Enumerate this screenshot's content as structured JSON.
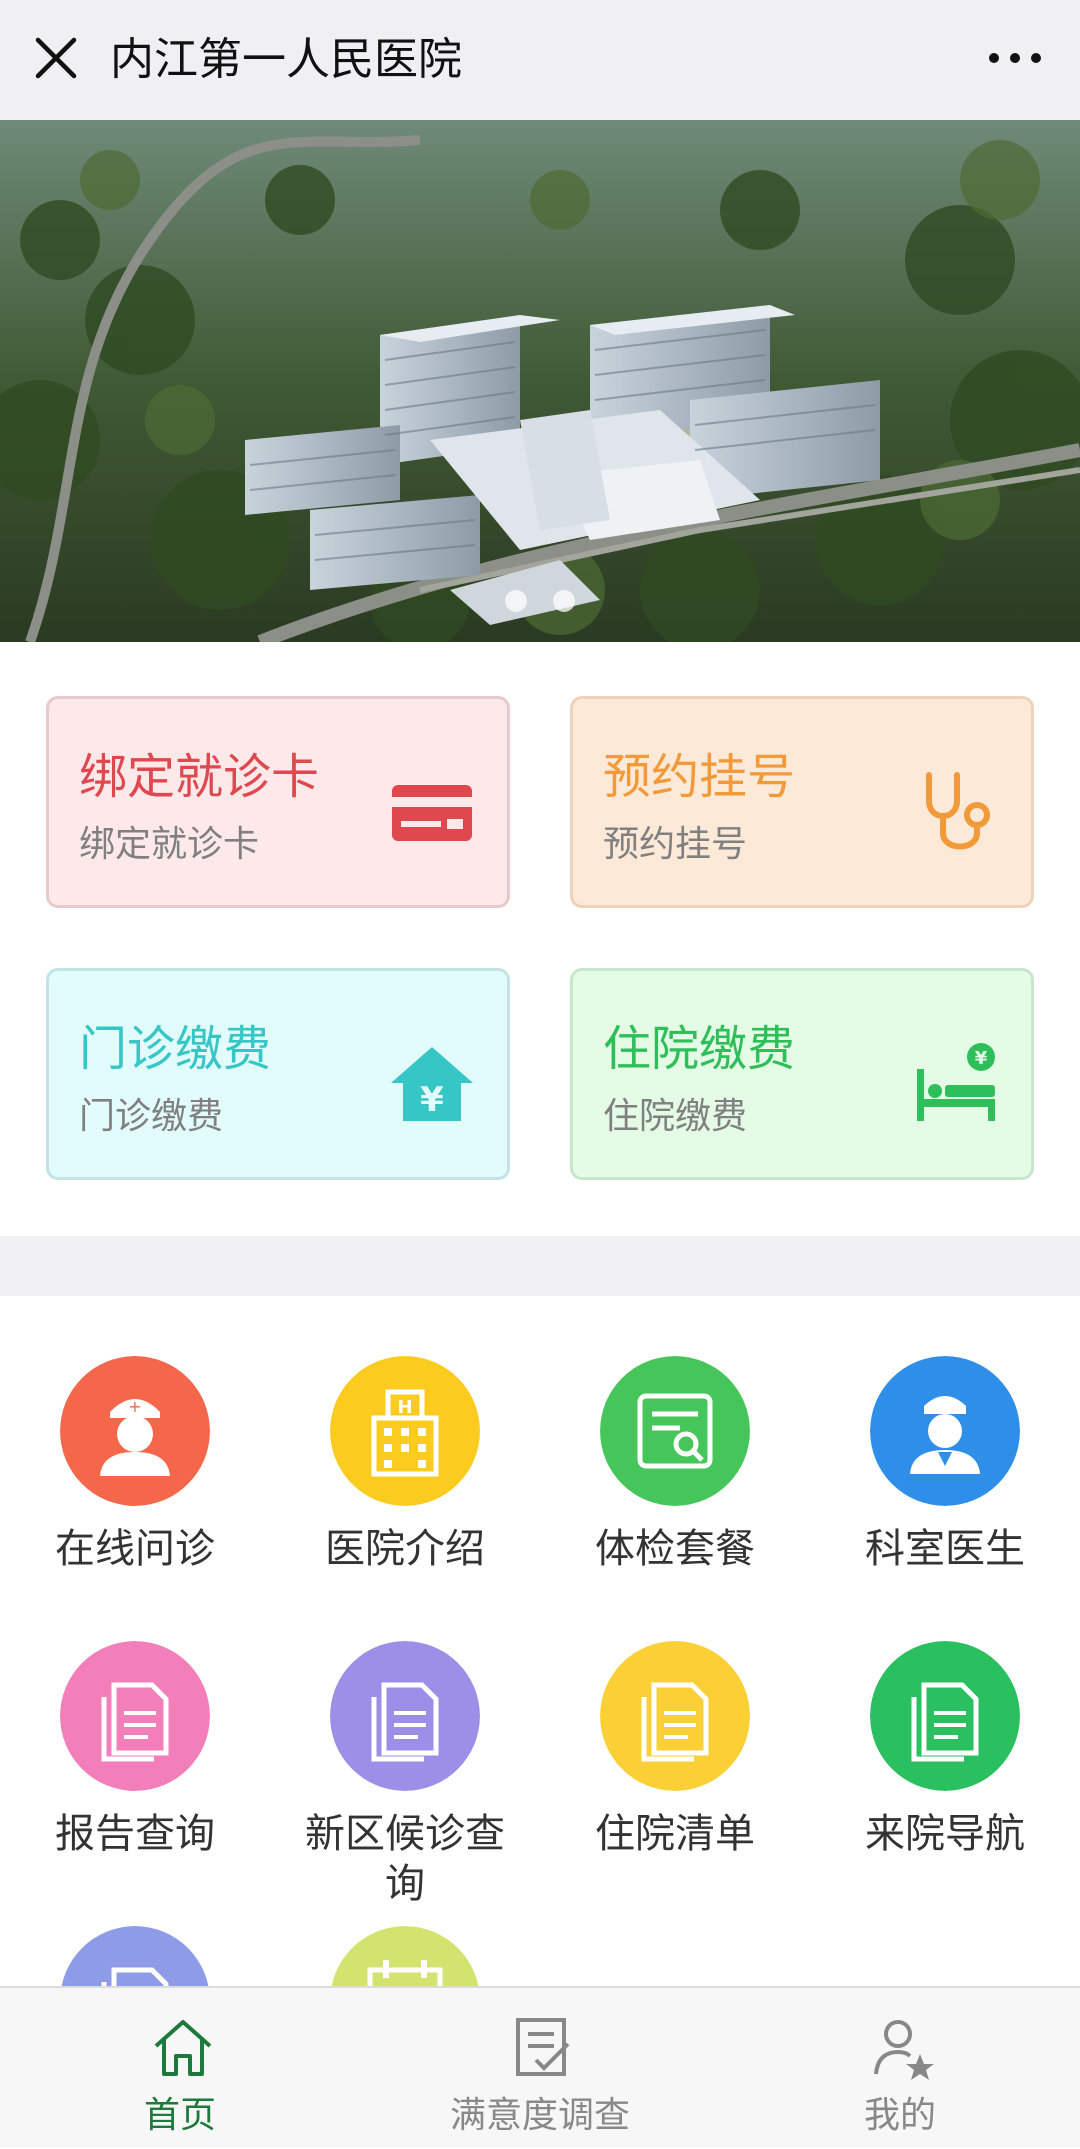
{
  "header": {
    "title": "内江第一人民医院",
    "close_icon": "close-icon",
    "more_icon": "more-icon"
  },
  "banner": {
    "slides": 2,
    "active_slide": 1
  },
  "quick_cards": [
    {
      "title": "绑定就诊卡",
      "subtitle": "绑定就诊卡",
      "icon": "card-icon",
      "color": "#e0484f",
      "bg": "#fde9ea",
      "border": "#e8c9cc"
    },
    {
      "title": "预约挂号",
      "subtitle": "预约挂号",
      "icon": "stethoscope-icon",
      "color": "#f29a3a",
      "bg": "#fde9d7",
      "border": "#eed3ba"
    },
    {
      "title": "门诊缴费",
      "subtitle": "门诊缴费",
      "icon": "yen-house-icon",
      "color": "#36c6c6",
      "bg": "#e2fbfb",
      "border": "#c3e3e6"
    },
    {
      "title": "住院缴费",
      "subtitle": "住院缴费",
      "icon": "bed-payment-icon",
      "color": "#2fbf5a",
      "bg": "#e4fbe6",
      "border": "#c7e6cb"
    }
  ],
  "services": [
    {
      "label": "在线问诊",
      "icon": "nurse-icon",
      "color": "#f5674b"
    },
    {
      "label": "医院介绍",
      "icon": "hospital-building-icon",
      "color": "#fbcc1f"
    },
    {
      "label": "体检套餐",
      "icon": "document-search-icon",
      "color": "#46c55a"
    },
    {
      "label": "科室医生",
      "icon": "doctor-icon",
      "color": "#2f8fe8"
    },
    {
      "label": "报告查询",
      "icon": "report-document-icon",
      "color": "#f27fb9"
    },
    {
      "label": "新区候诊查询",
      "label_line1": "新区候诊查",
      "label_line2": "询",
      "icon": "report-document-icon",
      "color": "#9d8fe8"
    },
    {
      "label": "住院清单",
      "icon": "report-document-icon",
      "color": "#fbcf36"
    },
    {
      "label": "来院导航",
      "icon": "report-document-icon",
      "color": "#2ac05f"
    },
    {
      "label": "",
      "icon": "report-document-icon",
      "color": "#8e9be6"
    },
    {
      "label": "",
      "icon": "calendar-icon",
      "color": "#d4e36f"
    }
  ],
  "tabbar": {
    "items": [
      {
        "label": "首页",
        "icon": "home-icon",
        "active": true
      },
      {
        "label": "满意度调查",
        "icon": "survey-icon",
        "active": false
      },
      {
        "label": "我的",
        "icon": "user-star-icon",
        "active": false
      }
    ],
    "active_color": "#1d7a3c"
  }
}
